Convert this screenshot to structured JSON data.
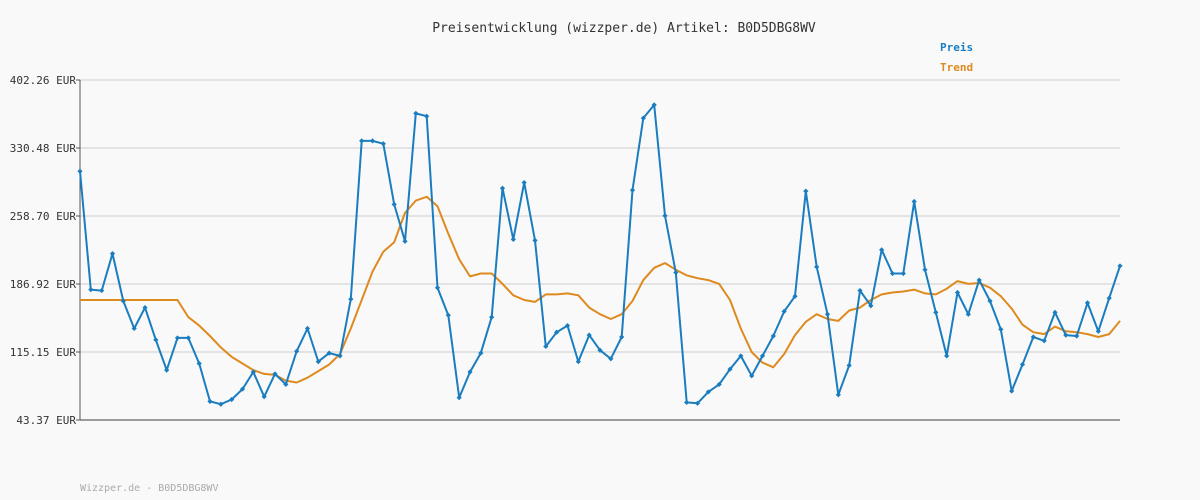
{
  "chart_data": {
    "type": "line",
    "title": "Preisentwicklung (wizzper.de) Artikel: B0D5DBG8WV",
    "y_ticks": [
      "402.26 EUR",
      "330.48 EUR",
      "258.70 EUR",
      "186.92 EUR",
      "115.15 EUR",
      "43.37 EUR"
    ],
    "ylim": [
      43.37,
      402.26
    ],
    "grid": true,
    "legend_position": "top-right",
    "footer": "Wizzper.de - B0D5DBG8WV",
    "series": [
      {
        "name": "Preis",
        "color": "#1a7dbf",
        "markers": true,
        "values": [
          306,
          181,
          180,
          219,
          169,
          140,
          162,
          128,
          96,
          130,
          130,
          103,
          63,
          60,
          65,
          76,
          94,
          68,
          92,
          81,
          116,
          140,
          105,
          114,
          111,
          171,
          338,
          338,
          335,
          271,
          232,
          367,
          364,
          183,
          154,
          67,
          94,
          114,
          152,
          288,
          234,
          294,
          233,
          121,
          136,
          143,
          105,
          133,
          117,
          108,
          131,
          286,
          362,
          376,
          259,
          199,
          62,
          61,
          73,
          81,
          97,
          111,
          90,
          111,
          132,
          158,
          174,
          285,
          205,
          155,
          70,
          101,
          180,
          164,
          223,
          198,
          198,
          274,
          202,
          157,
          111,
          178,
          155,
          191,
          169,
          139,
          74,
          102,
          131,
          127,
          157,
          133,
          132,
          167,
          137,
          172,
          206
        ]
      },
      {
        "name": "Trend",
        "color": "#de8a1f",
        "markers": false,
        "values": [
          170,
          170,
          170,
          170,
          170,
          170,
          170,
          170,
          170,
          170,
          152,
          143,
          132,
          120,
          110,
          103,
          96,
          92,
          91,
          85,
          83,
          88,
          95,
          102,
          113,
          140,
          170,
          200,
          221,
          231,
          262,
          275,
          279,
          269,
          240,
          213,
          195,
          198,
          198,
          187,
          175,
          170,
          168,
          176,
          176,
          177,
          175,
          162,
          155,
          150,
          155,
          169,
          191,
          204,
          209,
          202,
          196,
          193,
          191,
          187,
          170,
          140,
          115,
          104,
          99,
          113,
          133,
          147,
          155,
          150,
          148,
          159,
          162,
          170,
          176,
          178,
          179,
          181,
          177,
          176,
          182,
          190,
          187,
          188,
          183,
          174,
          161,
          144,
          136,
          134,
          142,
          137,
          136,
          134,
          131,
          134,
          148
        ]
      }
    ]
  }
}
